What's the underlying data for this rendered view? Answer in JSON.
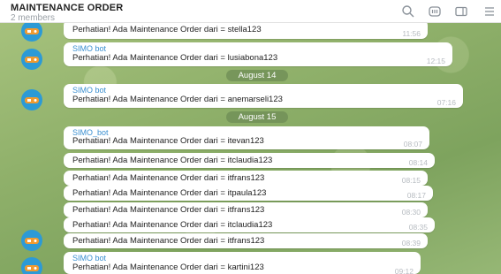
{
  "header": {
    "title": "MAINTENANCE ORDER",
    "subtitle": "2 members",
    "icons": [
      "search-icon",
      "poll-icon",
      "sidebar-toggle-icon",
      "menu-icon"
    ]
  },
  "colors": {
    "sender": "#3a8fd0",
    "bubble": "#ffffff",
    "time": "#b7bcc1",
    "date_pill": "#6e8c55",
    "avatar": "#2c9ad6"
  },
  "messages": [
    {
      "sender": "",
      "text": "Perhatian! Ada Maintenance Order dari = stella123",
      "time": "11:56"
    },
    {
      "sender": "SIMO bot",
      "text": "Perhatian! Ada Maintenance Order dari = lusiabona123",
      "time": "12:15"
    },
    {
      "date": "August 14"
    },
    {
      "sender": "SIMO bot",
      "text": "Perhatian! Ada Maintenance Order dari = anemarseli123",
      "time": "07:16"
    },
    {
      "date": "August 15"
    },
    {
      "sender": "SIMO_bot",
      "text": "Perhatian! Ada Maintenance Order dari = itevan123",
      "time": "08:07"
    },
    {
      "sender": "",
      "text": "Perhatian! Ada Maintenance Order dari = itclaudia123",
      "time": "08:14"
    },
    {
      "sender": "",
      "text": "Perhatian! Ada Maintenance Order dari = itfrans123",
      "time": "08:15"
    },
    {
      "sender": "",
      "text": "Perhatian! Ada Maintenance Order dari = itpaula123",
      "time": "08:17"
    },
    {
      "sender": "",
      "text": "Perhatian! Ada Maintenance Order dari = itfrans123",
      "time": "08:30"
    },
    {
      "sender": "",
      "text": "Perhatian! Ada Maintenance Order dari = itclaudia123",
      "time": "08:35"
    },
    {
      "sender": "",
      "text": "Perhatian! Ada Maintenance Order dari = itfrans123",
      "time": "08:39"
    },
    {
      "sender": "SIMO bot",
      "text": "Perhatian! Ada Maintenance Order dari = kartini123",
      "time": "09:12"
    }
  ]
}
